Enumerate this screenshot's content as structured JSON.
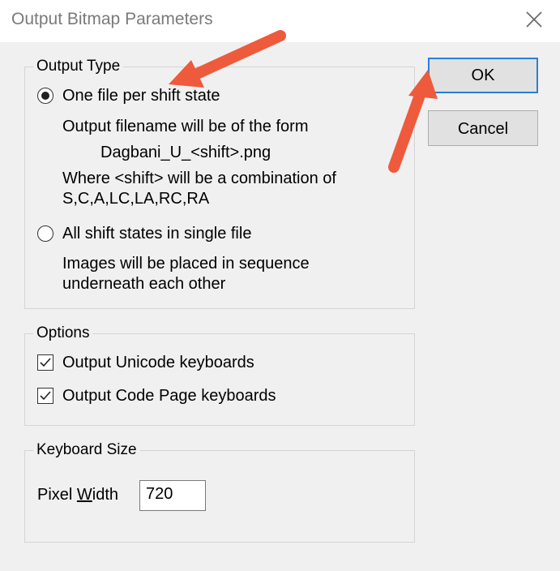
{
  "window": {
    "title": "Output Bitmap Parameters"
  },
  "output_type": {
    "legend": "Output Type",
    "option1_label": "One file per shift state",
    "option1_selected": true,
    "desc1_line1": "Output filename will be of the form",
    "desc1_line2": "Dagbani_U_<shift>.png",
    "desc1_line3": "Where <shift> will be a combination of",
    "desc1_line4": "S,C,A,LC,LA,RC,RA",
    "option2_label": "All shift states in single file",
    "option2_selected": false,
    "desc2_line1": "Images will be placed in sequence",
    "desc2_line2": "underneath each other"
  },
  "options": {
    "legend": "Options",
    "unicode_label": "Output Unicode keyboards",
    "unicode_checked": true,
    "codepage_label": "Output Code Page keyboards",
    "codepage_checked": true
  },
  "keyboard_size": {
    "legend": "Keyboard Size",
    "pixel_width_label_pre": "Pixel ",
    "pixel_width_label_ul": "W",
    "pixel_width_label_post": "idth",
    "pixel_width_value": "720"
  },
  "buttons": {
    "ok": "OK",
    "cancel": "Cancel"
  },
  "colors": {
    "accent": "#2b7fd8",
    "annotation_arrow": "#ee5a3c"
  },
  "icons": {
    "close": "close-icon",
    "check": "checkmark-icon"
  }
}
